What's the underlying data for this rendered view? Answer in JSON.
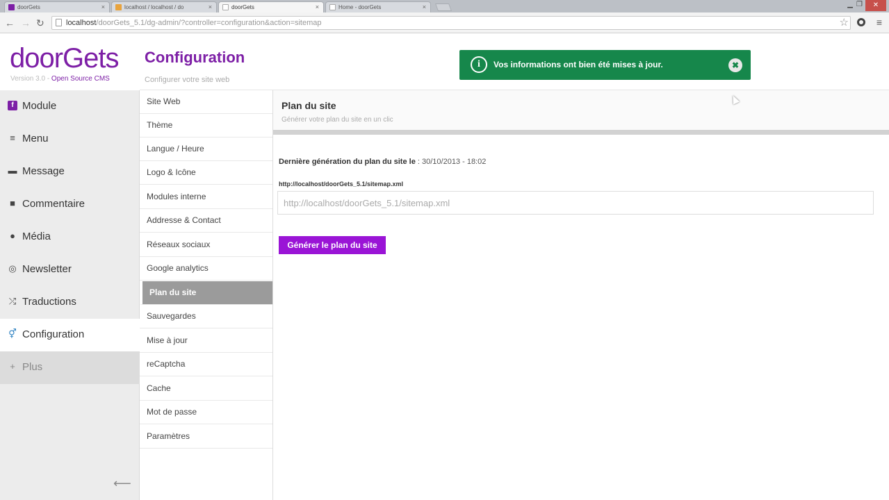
{
  "browser": {
    "tabs": [
      {
        "label": "doorGets",
        "favicon_color": "#7d1fa6"
      },
      {
        "label": "localhost / localhost / do",
        "favicon_color": "#e8a33d"
      },
      {
        "label": "doorGets",
        "favicon_color": "#cccccc"
      },
      {
        "label": "Home - doorGets",
        "favicon_color": "#cccccc"
      }
    ],
    "tab_close": "×",
    "url_host": "localhost",
    "url_path": "/doorGets_5.1/dg-admin/?controller=configuration&action=sitemap"
  },
  "brand": {
    "name": "doorGets",
    "version": "Version 3.0 - ",
    "tagline": "Open Source CMS",
    "accent": "#7d1fa6"
  },
  "sidebar": {
    "items": [
      {
        "label": "Module",
        "icon": "module-icon"
      },
      {
        "label": "Menu",
        "icon": "menu-icon"
      },
      {
        "label": "Message",
        "icon": "message-icon"
      },
      {
        "label": "Commentaire",
        "icon": "comment-icon"
      },
      {
        "label": "Média",
        "icon": "media-icon"
      },
      {
        "label": "Newsletter",
        "icon": "newsletter-icon"
      },
      {
        "label": "Traductions",
        "icon": "translation-icon"
      },
      {
        "label": "Configuration",
        "icon": "configuration-icon"
      },
      {
        "label": "Plus",
        "icon": "plus-icon"
      }
    ],
    "active": "Configuration",
    "collapse_arrow": "⟵"
  },
  "header": {
    "title": "Configuration",
    "subtitle": "Configurer votre site web"
  },
  "alert": {
    "message": "Vos informations ont bien été mises à jour.",
    "color": "#16874b"
  },
  "subnav": {
    "items": [
      "Site Web",
      "Thème",
      "Langue / Heure",
      "Logo & Icône",
      "Modules interne",
      "Addresse & Contact",
      "Réseaux sociaux",
      "Google analytics",
      "Plan du site",
      "Sauvegardes",
      "Mise à jour",
      "reCaptcha",
      "Cache",
      "Mot de passe",
      "Paramètres"
    ],
    "active": "Plan du site"
  },
  "panel": {
    "title": "Plan du site",
    "subtitle": "Générer votre plan du site en un clic",
    "last_generation_label": "Dernière génération du plan du site le",
    "last_generation_value": " : 30/10/2013 - 18:02",
    "url_label": "http://localhost/doorGets_5.1/sitemap.xml",
    "url_value": "http://localhost/doorGets_5.1/sitemap.xml",
    "button_label": "Générer le plan du site",
    "button_color": "#9a14d6"
  }
}
